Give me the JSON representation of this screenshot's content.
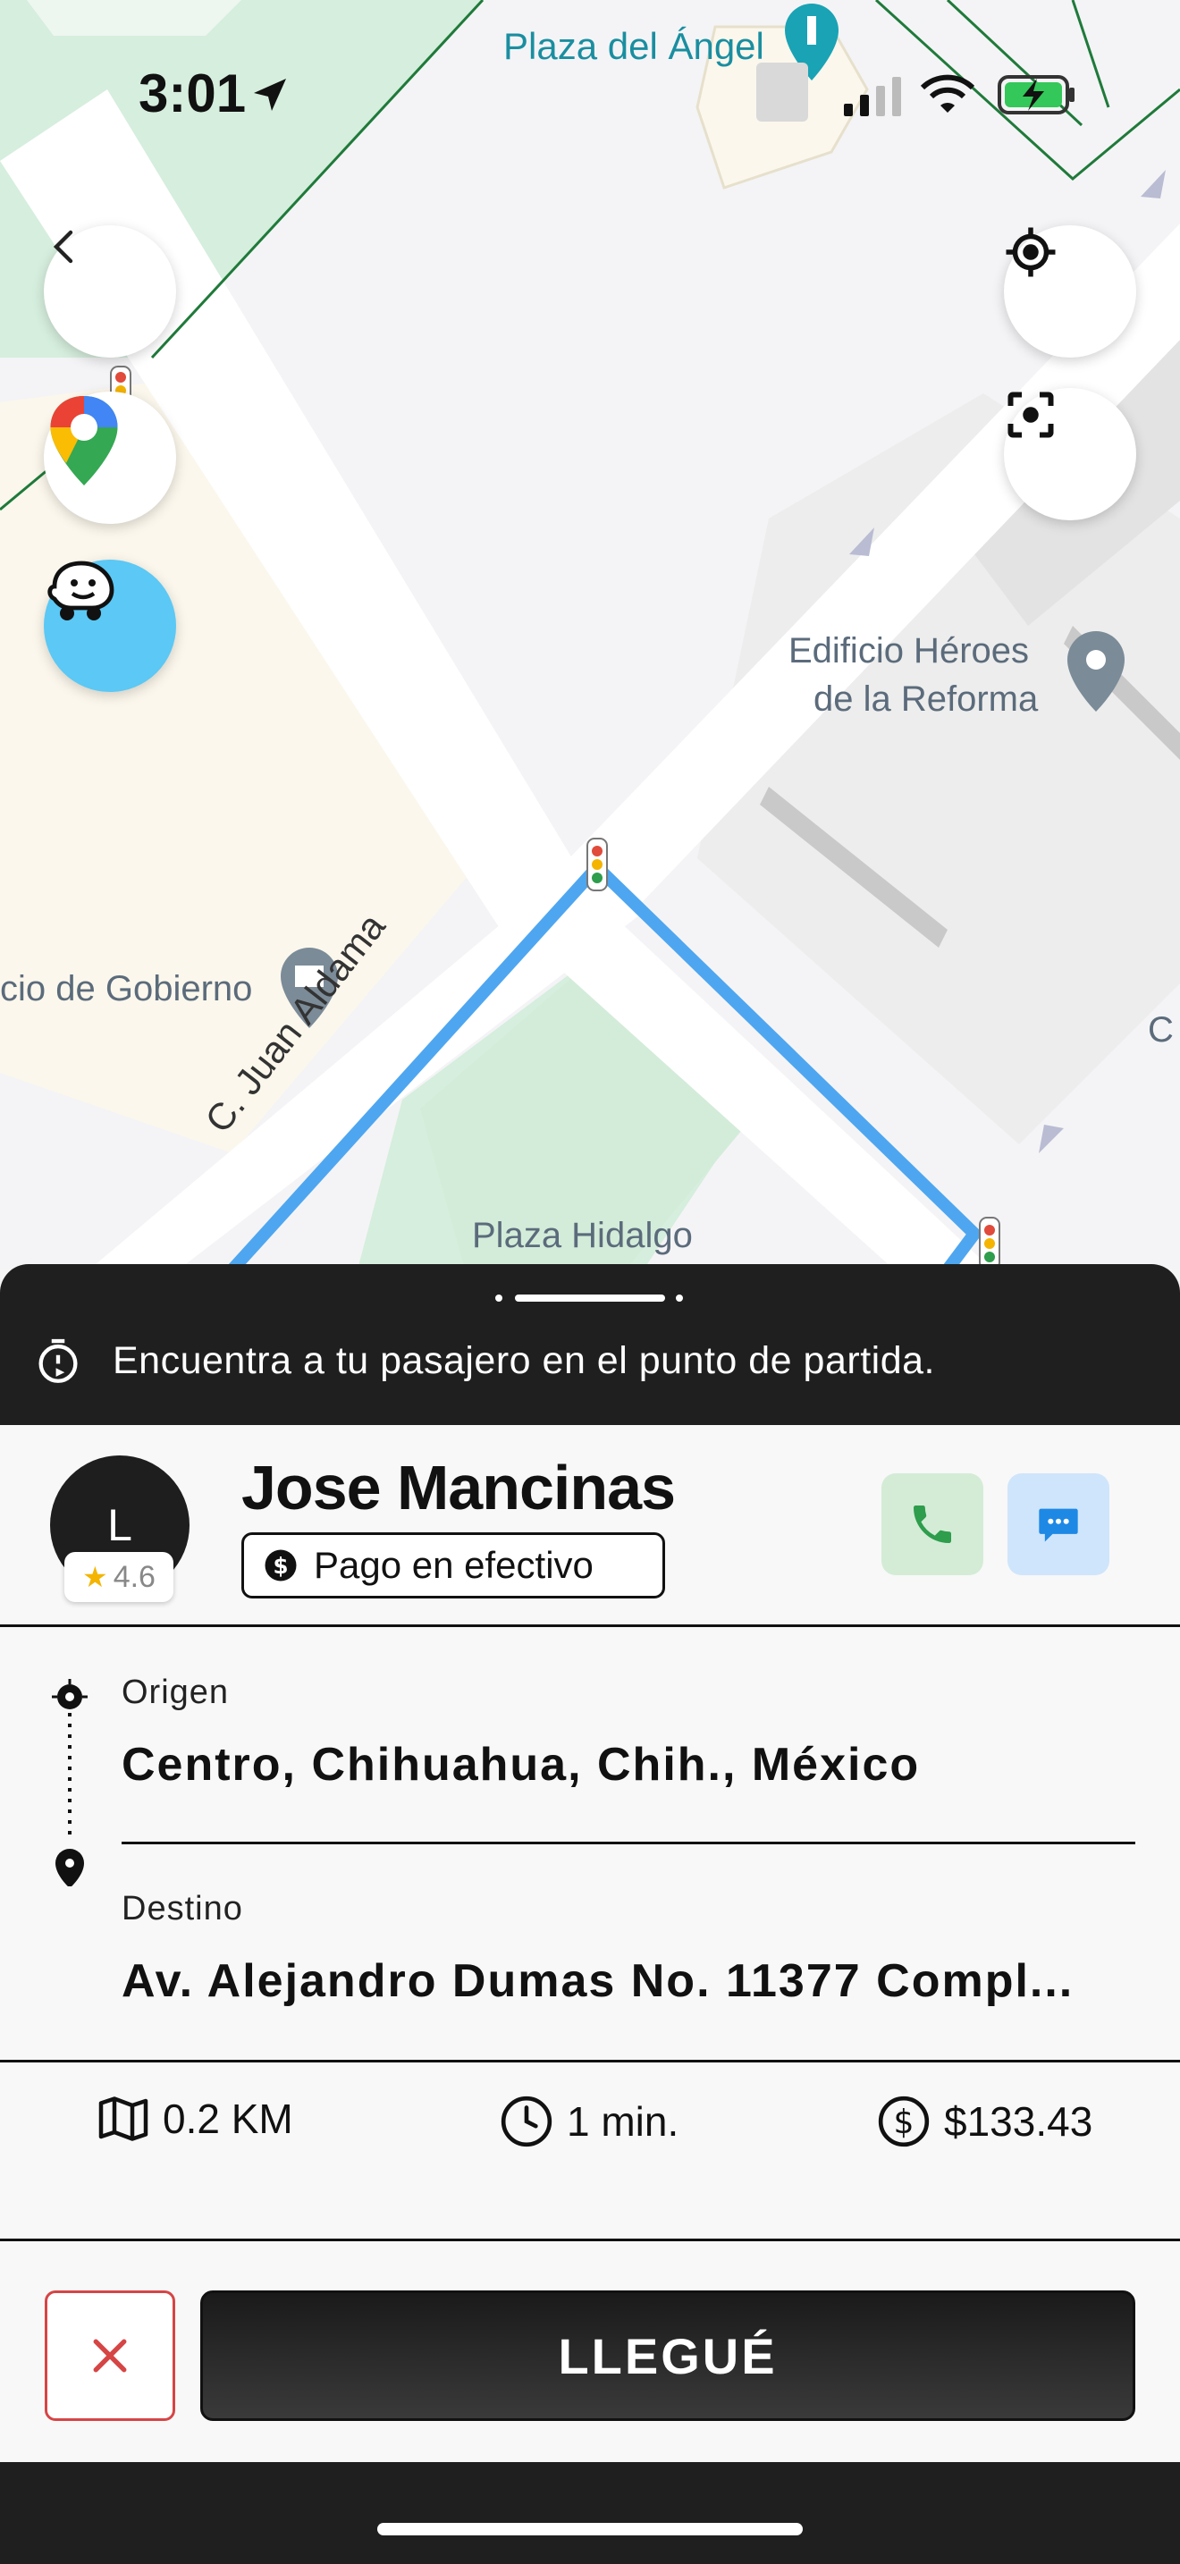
{
  "status_bar": {
    "time": "3:01"
  },
  "map": {
    "labels": {
      "plaza_angel": "Plaza del Ángel",
      "edificio_line1": "Edificio Héroes",
      "edificio_line2": "de la Reforma",
      "gobierno": "cio de Gobierno",
      "street": "C. Juan Aldama",
      "plaza_hidalgo": "Plaza Hidalgo",
      "edge_c": "C"
    },
    "route_color": "#4ea6f0"
  },
  "banner": {
    "message": "Encuentra a tu pasajero en el punto de partida."
  },
  "passenger": {
    "initial": "L",
    "rating": "4.6",
    "name": "Jose Mancinas",
    "payment": "Pago en efectivo"
  },
  "trip": {
    "origin_label": "Origen",
    "origin_value": "Centro, Chihuahua, Chih., México",
    "destination_label": "Destino",
    "destination_value": "Av. Alejandro Dumas No. 11377 Compl..."
  },
  "stats": {
    "distance": "0.2 KM",
    "time": "1 min.",
    "price": "$133.43"
  },
  "actions": {
    "arrived_label": "LLEGUÉ"
  },
  "colors": {
    "call_bg": "#d4ecd6",
    "message_bg": "#cfe5fb",
    "accent": "#1e88e5",
    "cancel": "#d64545"
  }
}
